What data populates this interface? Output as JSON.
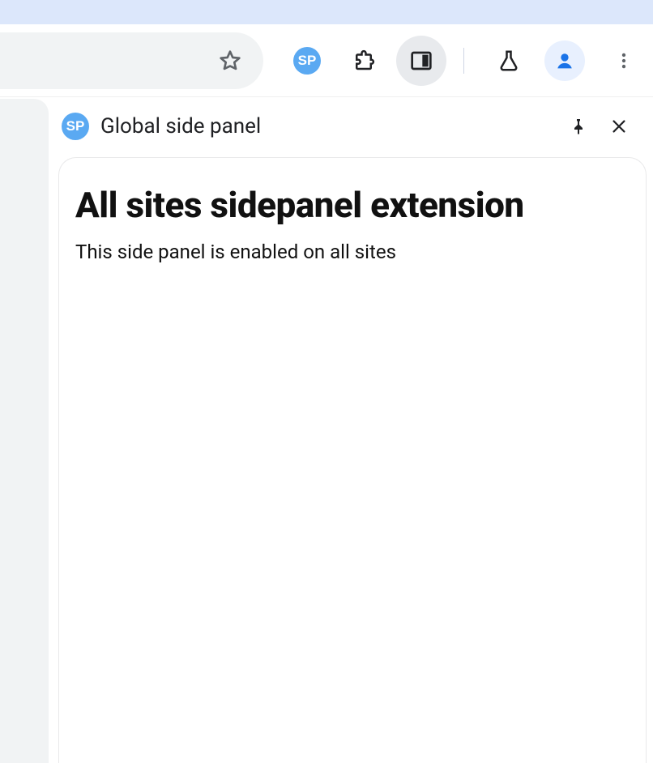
{
  "toolbar": {
    "extension_badge": "SP"
  },
  "sidepanel": {
    "badge": "SP",
    "title": "Global side panel",
    "heading": "All sites sidepanel extension",
    "description": "This side panel is enabled on all sites"
  }
}
